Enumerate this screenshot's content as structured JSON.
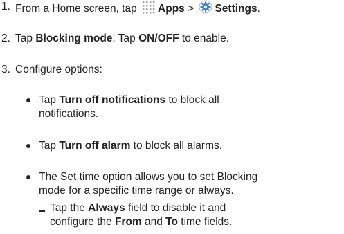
{
  "steps": [
    {
      "number": "1.",
      "text_before": "From a Home screen, tap ",
      "apps_icon": "apps-grid-icon",
      "apps_label": "Apps",
      "separator": " > ",
      "settings_icon": "settings-gear-icon",
      "settings_label": "Settings",
      "end": "."
    },
    {
      "number": "2.",
      "t1": "Tap ",
      "b1": "Blocking mode",
      "t2": ". Tap ",
      "b2": "ON/OFF",
      "t3": " to enable."
    },
    {
      "number": "3.",
      "text": "Configure options:"
    }
  ],
  "options": [
    {
      "t1": "Tap ",
      "b1": "Turn off notifications",
      "t2": " to block all",
      "line2": "notifications."
    },
    {
      "t1": "Tap ",
      "b1": "Turn off alarm",
      "t2": " to block all alarms."
    },
    {
      "line1": "The Set time option allows you to set Blocking",
      "line2": "mode for a specific time range or always."
    }
  ],
  "subitem": {
    "t1": "Tap the ",
    "b1": "Always",
    "t2": " field to disable it and",
    "t3": "configure the ",
    "b2": "From",
    "t4": " and ",
    "b3": "To",
    "t5": " time fields."
  },
  "colors": {
    "text": "#222222",
    "icon_grid": "#9a9a9a",
    "icon_gear": "#3a7fd5"
  }
}
